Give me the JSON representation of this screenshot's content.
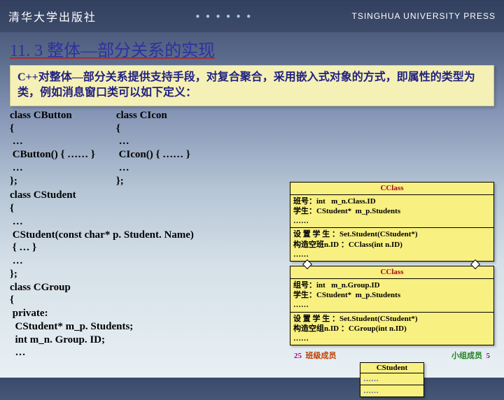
{
  "header": {
    "logo_cn": "清华大学出版社",
    "dots": "● ● ● ● ● ●",
    "logo_en": "TSINGHUA UNIVERSITY PRESS"
  },
  "title": "11. 3  整体—部分关系的实现",
  "intro": "C++对整体—部分关系提供支持手段，对复合聚合，采用嵌入式对象的方式，即属性的类型为类，例如消息窗口类可以如下定义：",
  "code": {
    "cbutton": "class CButton\n{\n …\n CButton() { …… }\n …\n};",
    "cicon": "class CIcon\n{\n …\n CIcon() { …… }\n …\n};",
    "cstudent": "class CStudent\n{\n …\n CStudent(const char* p. Student. Name)\n { … }\n …\n};\nclass CGroup\n{\n private:\n  CStudent* m_p. Students;\n  int m_n. Group. ID;\n  …"
  },
  "uml": {
    "box1": {
      "title": "CClass",
      "attrs": "班号：int   m_n.Class.ID\n学生：CStudent*  m_p.Students\n……",
      "ops": "设 置 学 生 ：Set.Student(CStudent*)\n构造空班n.ID ：CClass(int n.ID)\n……"
    },
    "box2": {
      "title": "CClass",
      "attrs": "组号：int   m_n.Group.ID\n学生：CStudent*  m_p.Students\n……",
      "ops": "设 置 学 生 ：Set.Student(CStudent*)\n构造空组n.ID ：CGroup(int n.ID)\n……"
    },
    "label_left_n": "25",
    "label_left_t": "班级成员",
    "label_right_t": "小组成员",
    "label_right_n": "5",
    "cstudent": {
      "title": "CStudent",
      "sec1": "……",
      "sec2": "……"
    }
  }
}
